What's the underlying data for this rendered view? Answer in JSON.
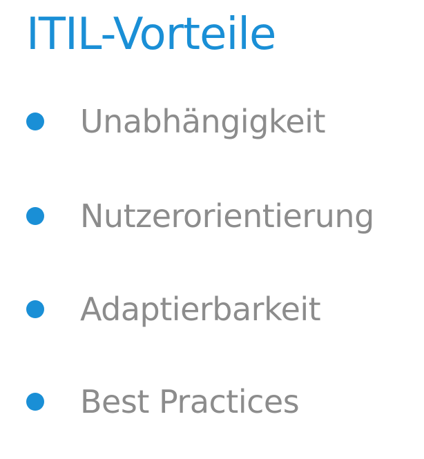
{
  "colors": {
    "accent": "#1a8fd6",
    "bullet": "#1a8fd6",
    "text": "#8c8c8c",
    "background": "#ffffff"
  },
  "slide": {
    "title": "ITIL-Vorteile",
    "bullets": [
      {
        "label": "Unabhängigkeit"
      },
      {
        "label": "Nutzerorientierung"
      },
      {
        "label": "Adaptierbarkeit"
      },
      {
        "label": "Best Practices"
      }
    ]
  }
}
